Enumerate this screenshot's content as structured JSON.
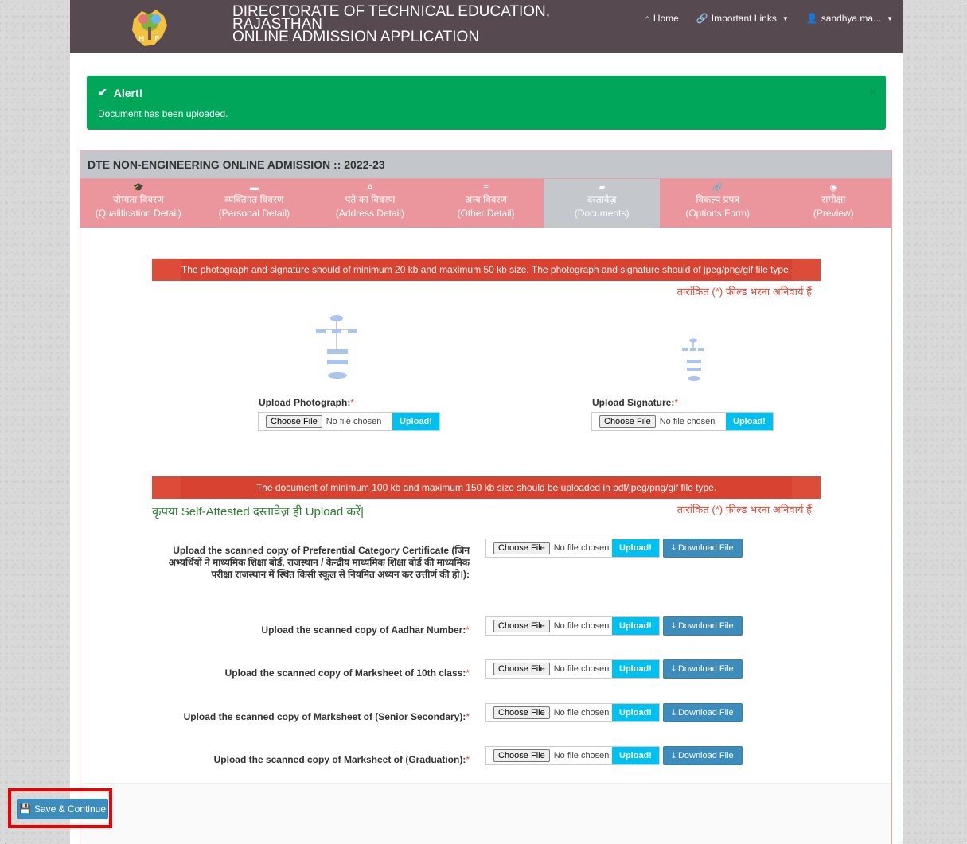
{
  "navbar": {
    "brand_line1": "DIRECTORATE OF TECHNICAL EDUCATION,",
    "brand_line2": "RAJASTHAN",
    "brand_line3": "ONLINE ADMISSION APPLICATION",
    "home": "Home",
    "important_links": "Important Links",
    "user": "sandhya ma..."
  },
  "alert": {
    "title": "Alert!",
    "message": "Document has been uploaded.",
    "close": "×"
  },
  "panel": {
    "title": "DTE NON-ENGINEERING ONLINE ADMISSION :: 2022-23"
  },
  "tabs": [
    {
      "icon": "graduation-cap-icon",
      "glyph": "🎓",
      "hindi": "योग्यता विवरण",
      "english": "(Qualification Detail)"
    },
    {
      "icon": "briefcase-icon",
      "glyph": "▬",
      "hindi": "व्यक्तिगत विवरण",
      "english": "(Personal Detail)"
    },
    {
      "icon": "road-icon",
      "glyph": "A",
      "hindi": "पते का विवरण",
      "english": "(Address Detail)"
    },
    {
      "icon": "list-icon",
      "glyph": "≡",
      "hindi": "अन्य विवरण",
      "english": "(Other Detail)"
    },
    {
      "icon": "folder-open-icon",
      "glyph": "▰",
      "hindi": "दस्तावेज़",
      "english": "(Documents)"
    },
    {
      "icon": "link-icon",
      "glyph": "🔗",
      "hindi": "विकल्प प्रपत्र",
      "english": "(Options Form)"
    },
    {
      "icon": "eye-icon",
      "glyph": "◉",
      "hindi": "समीक्षा",
      "english": "(Preview)"
    }
  ],
  "photo_section": {
    "notice": "The photograph and signature should of minimum 20 kb and maximum 50 kb size. The photograph and signature should of jpeg/png/gif file type.",
    "mandatory_note": "तारांकित (*) फील्ड भरना अनिवार्य हैं",
    "photo_label": "Upload Photograph:",
    "signature_label": "Upload Signature:",
    "required_mark": "*"
  },
  "file_input": {
    "choose": "Choose File",
    "no_file": "No file chosen",
    "upload": "Upload!",
    "download": "Download File"
  },
  "docs_section": {
    "notice": "The document of minimum 100 kb and maximum 150 kb size should be uploaded in pdf/jpeg/png/gif file type.",
    "self_attested_note": "कृपया Self-Attested दस्तावेज़ ही Upload करें|",
    "mandatory_note": "तारांकित (*) फील्ड भरना अनिवार्य हैं",
    "documents": [
      {
        "label": "Upload the scanned copy of Preferential Category Certificate (जिन अभ्यर्थियों ने माध्यमिक शिक्षा बोर्ड, राजस्थान / केन्द्रीय माध्यमिक शिक्षा बोर्ड की माध्यमिक परीक्षा राजस्थान में स्थित किसी स्कूल से नियमित अध्यन कर उत्तीर्ण की हो।):",
        "required": ""
      },
      {
        "label": "Upload the scanned copy of Aadhar Number:",
        "required": "*"
      },
      {
        "label": "Upload the scanned copy of Marksheet of 10th class:",
        "required": "*"
      },
      {
        "label": "Upload the scanned copy of Marksheet of (Senior Secondary):",
        "required": "*"
      },
      {
        "label": "Upload the scanned copy of Marksheet of (Graduation):",
        "required": "*"
      }
    ]
  },
  "footer": {
    "save": "Save & Continue"
  },
  "colors": {
    "navbar": "#56494f",
    "alert": "#00a65a",
    "tab": "#eb969d",
    "tab_active": "#c4c8cd",
    "notice": "#dd4b39",
    "upload": "#00c0ef",
    "primary": "#3c8dbc"
  }
}
